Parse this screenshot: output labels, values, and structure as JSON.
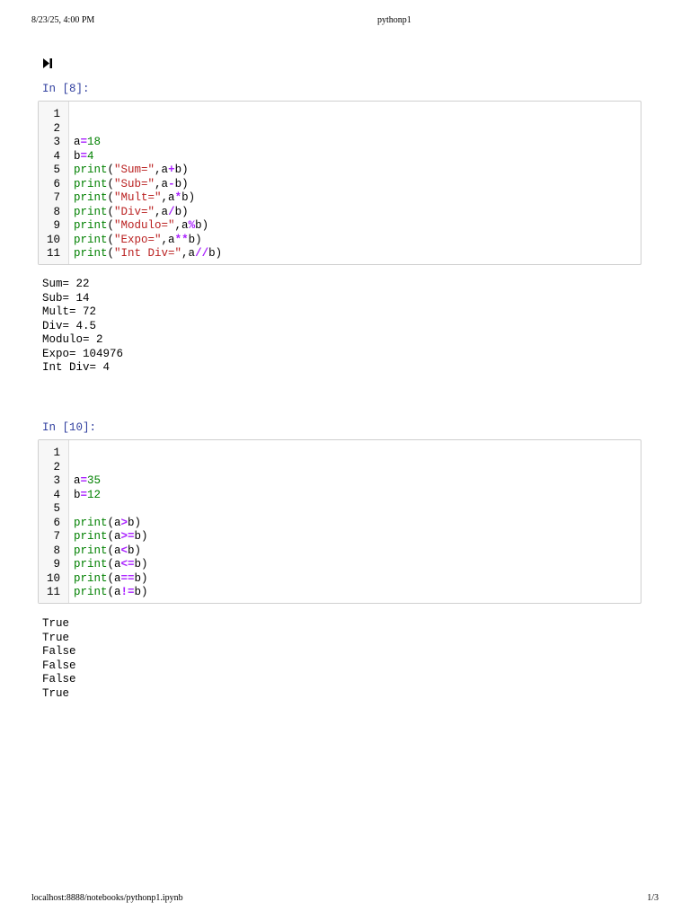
{
  "header": {
    "datetime": "8/23/25, 4:00 PM",
    "title": "pythonp1"
  },
  "footer": {
    "url": "localhost:8888/notebooks/pythonp1.ipynb",
    "page": "1/3"
  },
  "cells": [
    {
      "prompt": "In [8]:",
      "line_numbers": [
        "1",
        "2",
        "3",
        "4",
        "5",
        "6",
        "7",
        "8",
        "9",
        "10",
        "11"
      ],
      "lines": [
        [],
        [],
        [
          [
            "v",
            "a"
          ],
          [
            "o",
            "="
          ],
          [
            "n",
            "18"
          ]
        ],
        [
          [
            "v",
            "b"
          ],
          [
            "o",
            "="
          ],
          [
            "n",
            "4"
          ]
        ],
        [
          [
            "k",
            "print"
          ],
          [
            "v",
            "("
          ],
          [
            "s",
            "\"Sum=\""
          ],
          [
            "v",
            ",a"
          ],
          [
            "o",
            "+"
          ],
          [
            "v",
            "b)"
          ]
        ],
        [
          [
            "k",
            "print"
          ],
          [
            "v",
            "("
          ],
          [
            "s",
            "\"Sub=\""
          ],
          [
            "v",
            ",a"
          ],
          [
            "o",
            "-"
          ],
          [
            "v",
            "b)"
          ]
        ],
        [
          [
            "k",
            "print"
          ],
          [
            "v",
            "("
          ],
          [
            "s",
            "\"Mult=\""
          ],
          [
            "v",
            ",a"
          ],
          [
            "o",
            "*"
          ],
          [
            "v",
            "b)"
          ]
        ],
        [
          [
            "k",
            "print"
          ],
          [
            "v",
            "("
          ],
          [
            "s",
            "\"Div=\""
          ],
          [
            "v",
            ",a"
          ],
          [
            "o",
            "/"
          ],
          [
            "v",
            "b)"
          ]
        ],
        [
          [
            "k",
            "print"
          ],
          [
            "v",
            "("
          ],
          [
            "s",
            "\"Modulo=\""
          ],
          [
            "v",
            ",a"
          ],
          [
            "o",
            "%"
          ],
          [
            "v",
            "b)"
          ]
        ],
        [
          [
            "k",
            "print"
          ],
          [
            "v",
            "("
          ],
          [
            "s",
            "\"Expo=\""
          ],
          [
            "v",
            ",a"
          ],
          [
            "o",
            "**"
          ],
          [
            "v",
            "b)"
          ]
        ],
        [
          [
            "k",
            "print"
          ],
          [
            "v",
            "("
          ],
          [
            "s",
            "\"Int Div=\""
          ],
          [
            "v",
            ",a"
          ],
          [
            "o",
            "//"
          ],
          [
            "v",
            "b)"
          ]
        ]
      ],
      "output": [
        "Sum= 22",
        "Sub= 14",
        "Mult= 72",
        "Div= 4.5",
        "Modulo= 2",
        "Expo= 104976",
        "Int Div= 4"
      ]
    },
    {
      "prompt": "In [10]:",
      "line_numbers": [
        "1",
        "2",
        "3",
        "4",
        "5",
        "6",
        "7",
        "8",
        "9",
        "10",
        "11"
      ],
      "lines": [
        [],
        [],
        [
          [
            "v",
            "a"
          ],
          [
            "o",
            "="
          ],
          [
            "n",
            "35"
          ]
        ],
        [
          [
            "v",
            "b"
          ],
          [
            "o",
            "="
          ],
          [
            "n",
            "12"
          ]
        ],
        [],
        [
          [
            "k",
            "print"
          ],
          [
            "v",
            "(a"
          ],
          [
            "o",
            ">"
          ],
          [
            "v",
            "b)"
          ]
        ],
        [
          [
            "k",
            "print"
          ],
          [
            "v",
            "(a"
          ],
          [
            "o",
            ">="
          ],
          [
            "v",
            "b)"
          ]
        ],
        [
          [
            "k",
            "print"
          ],
          [
            "v",
            "(a"
          ],
          [
            "o",
            "<"
          ],
          [
            "v",
            "b)"
          ]
        ],
        [
          [
            "k",
            "print"
          ],
          [
            "v",
            "(a"
          ],
          [
            "o",
            "<="
          ],
          [
            "v",
            "b)"
          ]
        ],
        [
          [
            "k",
            "print"
          ],
          [
            "v",
            "(a"
          ],
          [
            "o",
            "=="
          ],
          [
            "v",
            "b)"
          ]
        ],
        [
          [
            "k",
            "print"
          ],
          [
            "v",
            "(a"
          ],
          [
            "o",
            "!="
          ],
          [
            "v",
            "b)"
          ]
        ]
      ],
      "output": [
        "True",
        "True",
        "False",
        "False",
        "False",
        "True"
      ]
    }
  ],
  "icons": {
    "run": "run-next-icon"
  }
}
